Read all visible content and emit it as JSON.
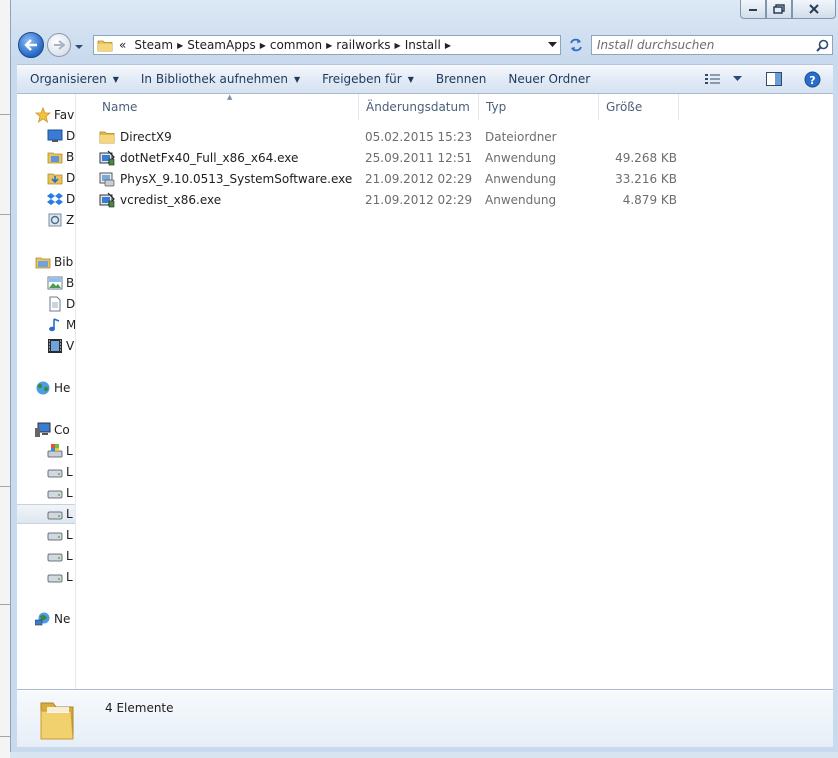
{
  "address": {
    "prefix": "«",
    "crumbs": [
      "Steam",
      "SteamApps",
      "common",
      "railworks",
      "Install"
    ]
  },
  "search": {
    "placeholder": "Install durchsuchen"
  },
  "toolbar": {
    "organize": "Organisieren",
    "library": "In Bibliothek aufnehmen",
    "share": "Freigeben für",
    "burn": "Brennen",
    "new_folder": "Neuer Ordner"
  },
  "nav": {
    "favorites": "Fav",
    "fav_items": [
      "D",
      "B",
      "D",
      "D",
      "Z"
    ],
    "libraries": "Bib",
    "lib_items": [
      "B",
      "D",
      "M",
      "V"
    ],
    "homegroup": "He",
    "computer": "Co",
    "drives": [
      "L",
      "L",
      "L",
      "L",
      "L",
      "L",
      "L"
    ],
    "network": "Ne"
  },
  "columns": {
    "name": "Name",
    "date": "Änderungsdatum",
    "type": "Typ",
    "size": "Größe"
  },
  "files": [
    {
      "name": "DirectX9",
      "date": "05.02.2015 15:23",
      "type": "Dateiordner",
      "size": "",
      "icon": "folder-icon"
    },
    {
      "name": "dotNetFx40_Full_x86_x64.exe",
      "date": "25.09.2011 12:51",
      "type": "Anwendung",
      "size": "49.268 KB",
      "icon": "installer-icon"
    },
    {
      "name": "PhysX_9.10.0513_SystemSoftware.exe",
      "date": "21.09.2012 02:29",
      "type": "Anwendung",
      "size": "33.216 KB",
      "icon": "setup-icon"
    },
    {
      "name": "vcredist_x86.exe",
      "date": "21.09.2012 02:29",
      "type": "Anwendung",
      "size": "4.879 KB",
      "icon": "installer-icon"
    }
  ],
  "status": {
    "count": "4 Elemente"
  },
  "colors": {
    "accent": "#1e395b",
    "window": "#c9daee",
    "selection": "#dde6ef"
  }
}
